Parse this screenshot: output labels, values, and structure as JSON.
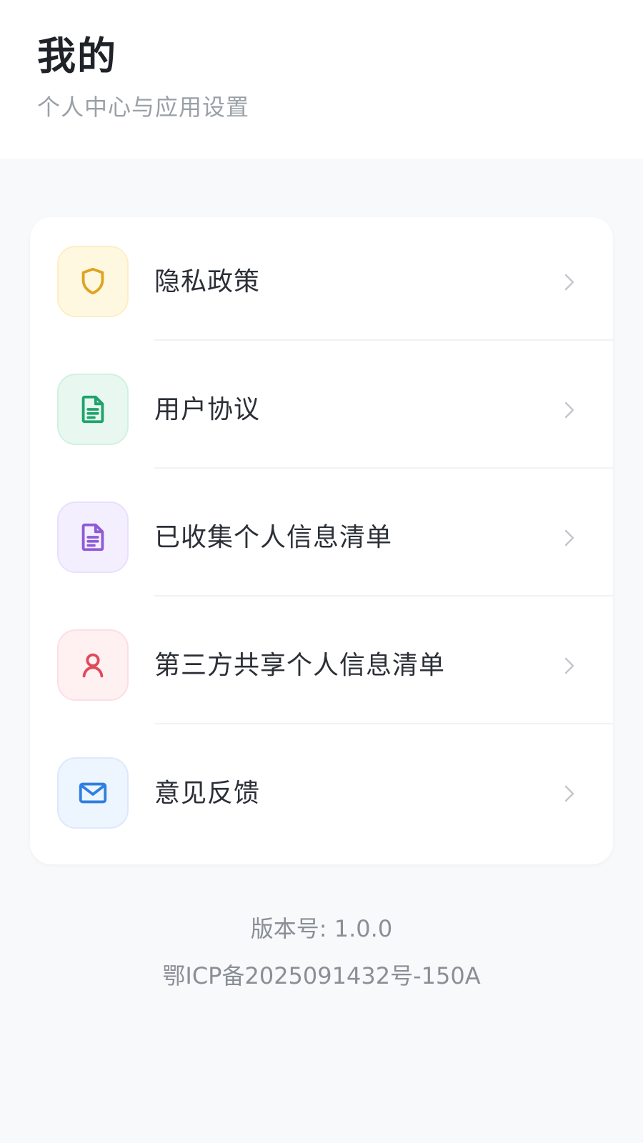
{
  "header": {
    "title": "我的",
    "subtitle": "个人中心与应用设置"
  },
  "menu": {
    "items": [
      {
        "label": "隐私政策",
        "icon": "shield-icon",
        "color": "#e0a321",
        "bg": "#fff8e1"
      },
      {
        "label": "用户协议",
        "icon": "document-icon",
        "color": "#1fa36b",
        "bg": "#e8f8f0"
      },
      {
        "label": "已收集个人信息清单",
        "icon": "document-icon",
        "color": "#8e5bd8",
        "bg": "#f4efff"
      },
      {
        "label": "第三方共享个人信息清单",
        "icon": "user-icon",
        "color": "#e04a5a",
        "bg": "#fff0f1"
      },
      {
        "label": "意见反馈",
        "icon": "mail-icon",
        "color": "#2f80e0",
        "bg": "#edf5ff"
      }
    ]
  },
  "footer": {
    "version": "版本号: 1.0.0",
    "icp": "鄂ICP备2025091432号-150A"
  }
}
